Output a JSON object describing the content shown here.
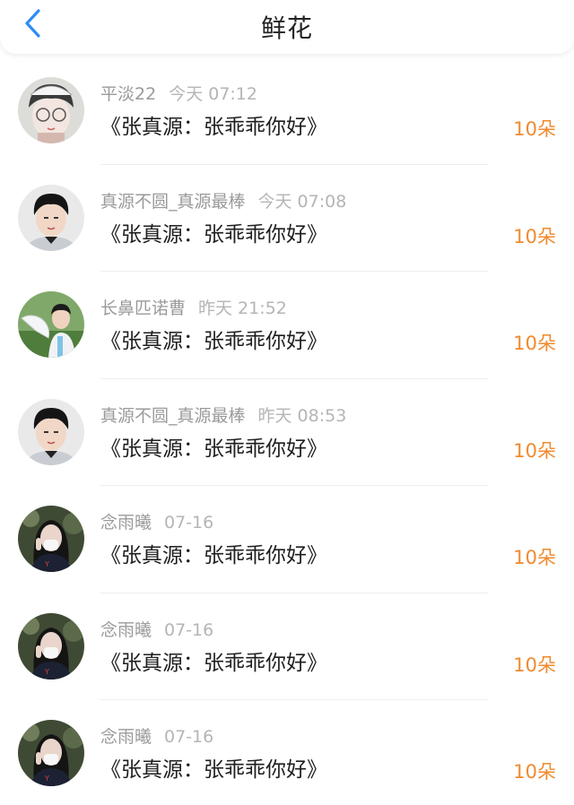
{
  "header": {
    "title": "鲜花",
    "accent_color": "#2f8cf5"
  },
  "items": [
    {
      "name": "平淡22",
      "time": "今天 07:12",
      "message": "《张真源：张乖乖你好》",
      "count": "10朵",
      "avatar": "avatar-girl-glasses"
    },
    {
      "name": "真源不圆_真源最棒",
      "time": "今天 07:08",
      "message": "《张真源：张乖乖你好》",
      "count": "10朵",
      "avatar": "avatar-boy-portrait"
    },
    {
      "name": "长鼻匹诺曹",
      "time": "昨天 21:52",
      "message": "《张真源：张乖乖你好》",
      "count": "10朵",
      "avatar": "avatar-boy-fan"
    },
    {
      "name": "真源不圆_真源最棒",
      "time": "昨天 08:53",
      "message": "《张真源：张乖乖你好》",
      "count": "10朵",
      "avatar": "avatar-boy-portrait"
    },
    {
      "name": "念雨曦",
      "time": "07-16",
      "message": "《张真源：张乖乖你好》",
      "count": "10朵",
      "avatar": "avatar-girl-mask"
    },
    {
      "name": "念雨曦",
      "time": "07-16",
      "message": "《张真源：张乖乖你好》",
      "count": "10朵",
      "avatar": "avatar-girl-mask"
    },
    {
      "name": "念雨曦",
      "time": "07-16",
      "message": "《张真源：张乖乖你好》",
      "count": "10朵",
      "avatar": "avatar-girl-mask"
    }
  ]
}
